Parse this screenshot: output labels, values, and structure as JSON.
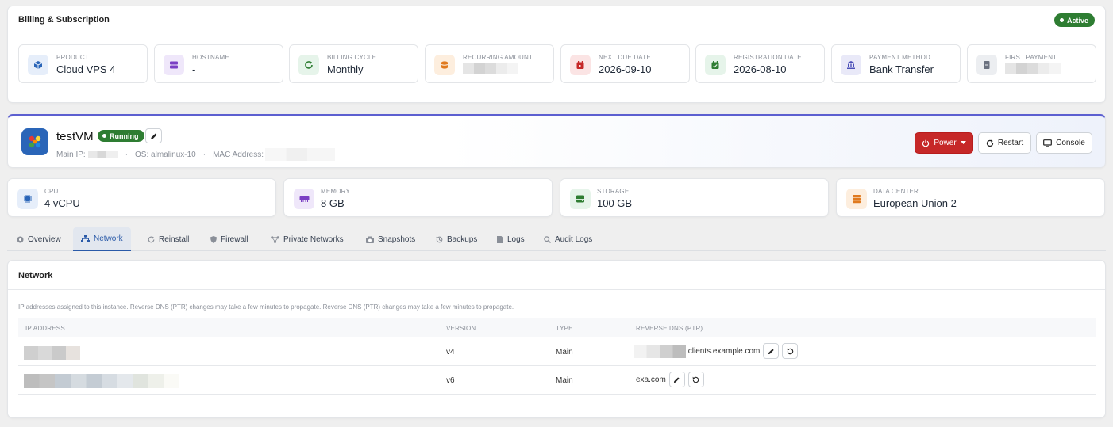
{
  "billing": {
    "title": "Billing & Subscription",
    "status": "Active",
    "items": [
      {
        "label": "PRODUCT",
        "value": "Cloud VPS 4",
        "icon": "cube-icon",
        "color": "#2a65b8",
        "bg": "#e6eefa"
      },
      {
        "label": "HOSTNAME",
        "value": "-",
        "icon": "server-icon",
        "color": "#7b3fc4",
        "bg": "#efe7fa"
      },
      {
        "label": "BILLING CYCLE",
        "value": "Monthly",
        "icon": "refresh-icon",
        "color": "#2e7d32",
        "bg": "#e6f4ea"
      },
      {
        "label": "RECURRING AMOUNT",
        "value": "",
        "icon": "coins-icon",
        "color": "#e07a1f",
        "bg": "#fdeede"
      },
      {
        "label": "NEXT DUE DATE",
        "value": "2026-09-10",
        "icon": "calendar-due-icon",
        "color": "#c62828",
        "bg": "#fbe4e4"
      },
      {
        "label": "REGISTRATION DATE",
        "value": "2026-08-10",
        "icon": "calendar-check-icon",
        "color": "#2e7d32",
        "bg": "#e6f4ea"
      },
      {
        "label": "PAYMENT METHOD",
        "value": "Bank Transfer",
        "icon": "bank-icon",
        "color": "#4b4fb8",
        "bg": "#e9e9f8"
      },
      {
        "label": "FIRST PAYMENT",
        "value": "",
        "icon": "receipt-icon",
        "color": "#6b7280",
        "bg": "#eceef1"
      }
    ]
  },
  "vm": {
    "name": "testVM",
    "status": "Running",
    "main_ip_label": "Main IP:",
    "os_label": "OS: almalinux-10",
    "mac_label": "MAC Address:",
    "power_label": "Power",
    "restart_label": "Restart",
    "console_label": "Console"
  },
  "specs": [
    {
      "label": "CPU",
      "value": "4 vCPU",
      "icon": "cpu-icon",
      "color": "#2a65b8",
      "bg": "#e6eefa"
    },
    {
      "label": "MEMORY",
      "value": "8 GB",
      "icon": "memory-icon",
      "color": "#7b3fc4",
      "bg": "#efe7fa"
    },
    {
      "label": "STORAGE",
      "value": "100 GB",
      "icon": "storage-icon",
      "color": "#2e7d32",
      "bg": "#e6f4ea"
    },
    {
      "label": "DATA CENTER",
      "value": "European Union 2",
      "icon": "datacenter-icon",
      "color": "#e07a1f",
      "bg": "#fdeede"
    }
  ],
  "tabs": [
    {
      "label": "Overview",
      "icon": "overview-icon"
    },
    {
      "label": "Network",
      "icon": "network-icon",
      "active": true
    },
    {
      "label": "Reinstall",
      "icon": "reinstall-icon"
    },
    {
      "label": "Firewall",
      "icon": "shield-icon"
    },
    {
      "label": "Private Networks",
      "icon": "private-network-icon"
    },
    {
      "label": "Snapshots",
      "icon": "camera-icon"
    },
    {
      "label": "Backups",
      "icon": "history-icon"
    },
    {
      "label": "Logs",
      "icon": "file-icon"
    },
    {
      "label": "Audit Logs",
      "icon": "search-icon"
    }
  ],
  "network": {
    "title": "Network",
    "description": "IP addresses assigned to this instance. Reverse DNS (PTR) changes may take a few minutes to propagate. Reverse DNS (PTR) changes may take a few minutes to propagate.",
    "columns": [
      "IP ADDRESS",
      "VERSION",
      "TYPE",
      "REVERSE DNS (PTR)"
    ],
    "rows": [
      {
        "version": "v4",
        "type": "Main",
        "rdns": ".clients.example.com"
      },
      {
        "version": "v6",
        "type": "Main",
        "rdns": "exa.com"
      }
    ]
  }
}
